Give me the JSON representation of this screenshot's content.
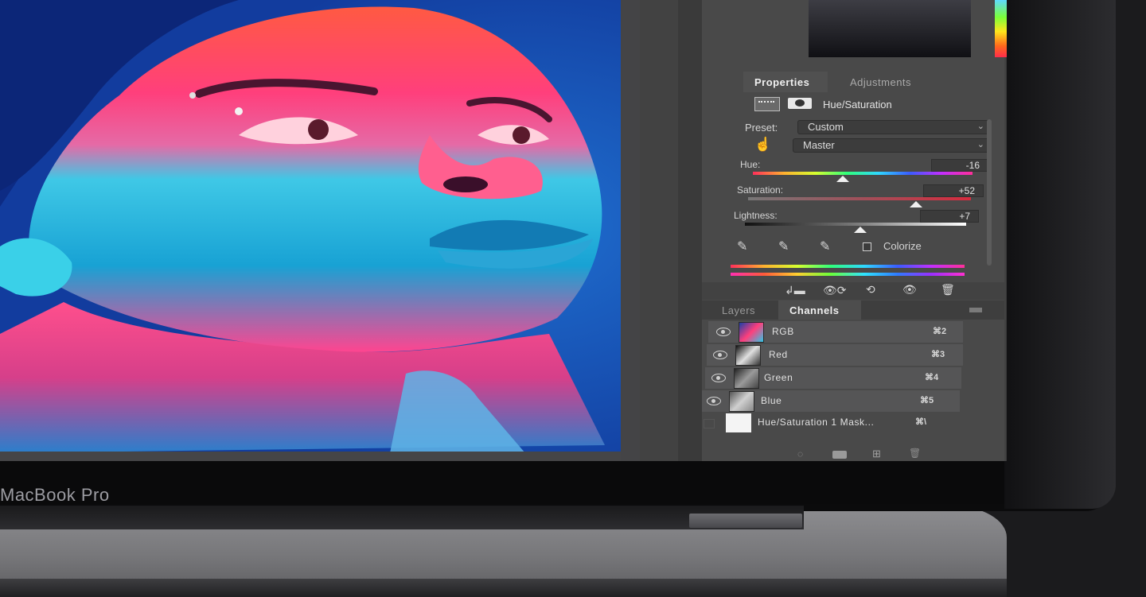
{
  "device": {
    "label": "MacBook Pro"
  },
  "colors": {
    "panel_bg": "#494949",
    "photo_bg": "#14399a",
    "face_warm": "#ff3d6e",
    "face_cool": "#2fc6e6"
  },
  "properties_panel": {
    "tabs": [
      {
        "label": "Properties",
        "active": true
      },
      {
        "label": "Adjustments",
        "active": false
      }
    ],
    "adjustment_name": "Hue/Saturation",
    "preset_label": "Preset:",
    "preset_value": "Custom",
    "channel_value": "Master",
    "sliders": [
      {
        "label": "Hue:",
        "value": "-16",
        "position": 0.42
      },
      {
        "label": "Saturation:",
        "value": "+52",
        "position": 0.73
      },
      {
        "label": "Lightness:",
        "value": "+7",
        "position": 0.52
      }
    ],
    "colorize_label": "Colorize",
    "colorize_checked": false,
    "footer_icons": [
      "clip-to-layer-icon",
      "view-previous-icon",
      "reset-icon",
      "visibility-icon",
      "trash-icon"
    ]
  },
  "channels_panel": {
    "tabs": [
      {
        "label": "Layers",
        "active": false
      },
      {
        "label": "Channels",
        "active": true
      }
    ],
    "rows": [
      {
        "name": "RGB",
        "shortcut": "⌘2",
        "visible": true
      },
      {
        "name": "Red",
        "shortcut": "⌘3",
        "visible": true
      },
      {
        "name": "Green",
        "shortcut": "⌘4",
        "visible": true
      },
      {
        "name": "Blue",
        "shortcut": "⌘5",
        "visible": true
      },
      {
        "name": "Hue/Saturation 1 Mask...",
        "shortcut": "⌘\\",
        "visible": false
      }
    ],
    "footer_icons": [
      "load-selection-icon",
      "save-selection-icon",
      "new-channel-icon",
      "delete-channel-icon"
    ]
  }
}
